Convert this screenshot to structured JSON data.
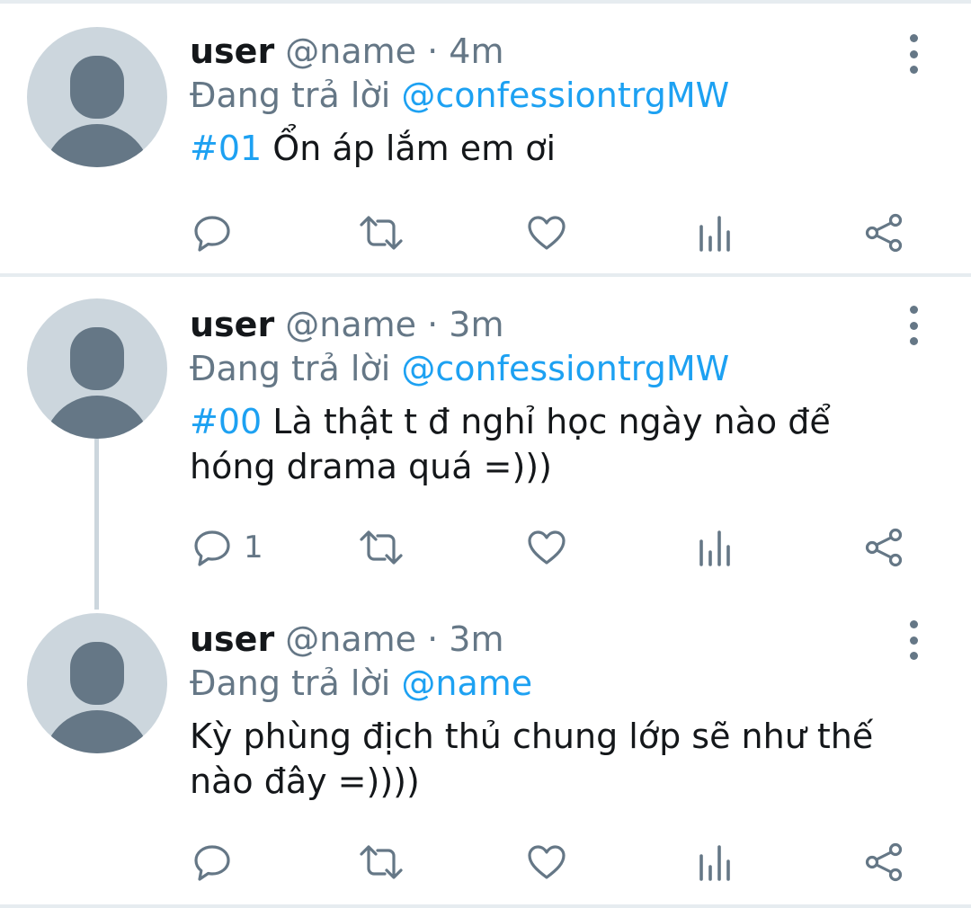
{
  "colors": {
    "accent": "#1da1f2",
    "muted": "#657786",
    "text": "#14171a",
    "avatar_bg": "#ccd6dd",
    "divider": "#e6ecf0"
  },
  "tweets": [
    {
      "display_name": "user",
      "meta": "@name · 4m",
      "reply_prefix": "Đang trả lời",
      "reply_to": "@confessiontrgMW",
      "hashtag": "#01",
      "text": " Ổn áp lắm em ơi",
      "reply_count": "",
      "icons": [
        "reply-icon",
        "retweet-icon",
        "like-icon",
        "analytics-icon",
        "share-icon",
        "more-icon"
      ]
    },
    {
      "display_name": "user",
      "meta": "@name · 3m",
      "reply_prefix": "Đang trả lời",
      "reply_to": "@confessiontrgMW",
      "hashtag": "#00",
      "text": " Là thật t đ nghỉ học ngày nào để hóng drama quá =)))",
      "reply_count": "1",
      "icons": [
        "reply-icon",
        "retweet-icon",
        "like-icon",
        "analytics-icon",
        "share-icon",
        "more-icon"
      ]
    },
    {
      "display_name": "user",
      "meta": "@name · 3m",
      "reply_prefix": "Đang trả lời",
      "reply_to": "@name",
      "hashtag": "",
      "text": "Kỳ phùng địch thủ chung lớp sẽ như thế nào đây =))))",
      "reply_count": "",
      "icons": [
        "reply-icon",
        "retweet-icon",
        "like-icon",
        "analytics-icon",
        "share-icon",
        "more-icon"
      ]
    }
  ]
}
